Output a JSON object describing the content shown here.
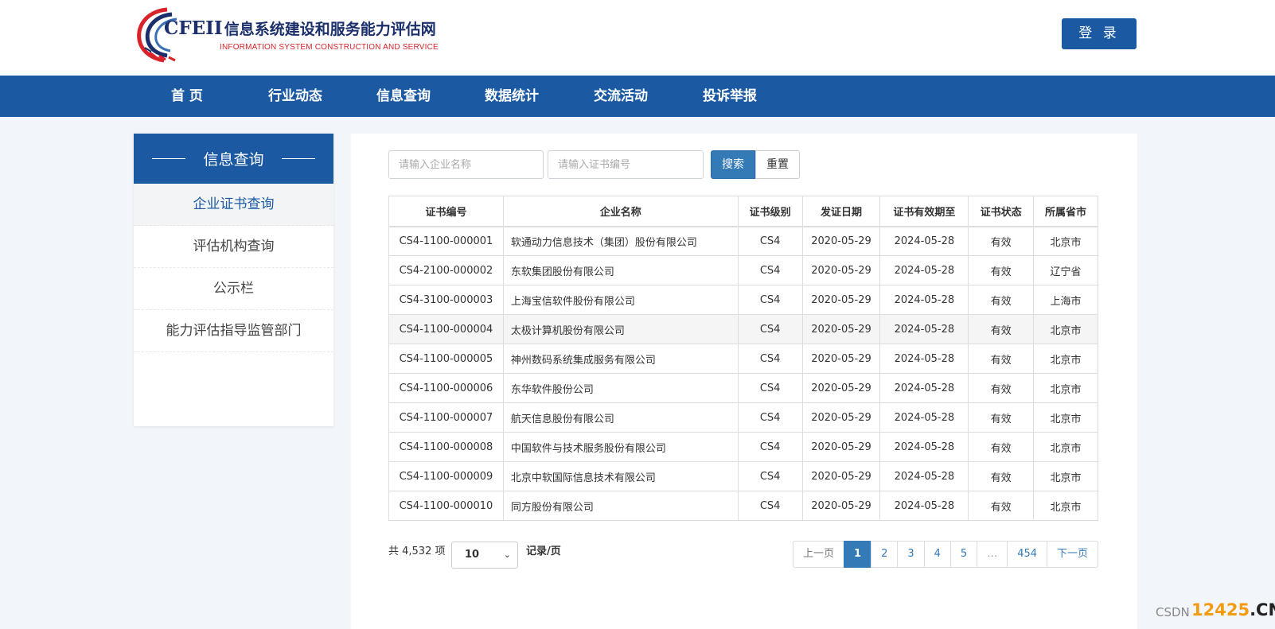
{
  "brand": {
    "abbr": "CFEII",
    "name_cn": "信息系统建设和服务能力评估网",
    "name_en": "INFORMATION SYSTEM CONSTRUCTION AND SERVICE",
    "colors": {
      "primary": "#1b5aa3",
      "accent_red": "#d8232a"
    }
  },
  "header": {
    "login_label": "登 录"
  },
  "nav": {
    "items": [
      {
        "label": "首 页"
      },
      {
        "label": "行业动态"
      },
      {
        "label": "信息查询"
      },
      {
        "label": "数据统计"
      },
      {
        "label": "交流活动"
      },
      {
        "label": "投诉举报"
      }
    ]
  },
  "sidebar": {
    "title": "信息查询",
    "items": [
      {
        "label": "企业证书查询",
        "active": true
      },
      {
        "label": "评估机构查询",
        "active": false
      },
      {
        "label": "公示栏",
        "active": false
      },
      {
        "label": "能力评估指导监管部门",
        "active": false
      }
    ]
  },
  "search": {
    "company_placeholder": "请输入企业名称",
    "cert_placeholder": "请输入证书编号",
    "search_label": "搜索",
    "reset_label": "重置"
  },
  "table": {
    "columns": [
      "证书编号",
      "企业名称",
      "证书级别",
      "发证日期",
      "证书有效期至",
      "证书状态",
      "所属省市"
    ],
    "rows": [
      [
        "CS4-1100-000001",
        "软通动力信息技术（集团）股份有限公司",
        "CS4",
        "2020-05-29",
        "2024-05-28",
        "有效",
        "北京市"
      ],
      [
        "CS4-2100-000002",
        "东软集团股份有限公司",
        "CS4",
        "2020-05-29",
        "2024-05-28",
        "有效",
        "辽宁省"
      ],
      [
        "CS4-3100-000003",
        "上海宝信软件股份有限公司",
        "CS4",
        "2020-05-29",
        "2024-05-28",
        "有效",
        "上海市"
      ],
      [
        "CS4-1100-000004",
        "太极计算机股份有限公司",
        "CS4",
        "2020-05-29",
        "2024-05-28",
        "有效",
        "北京市"
      ],
      [
        "CS4-1100-000005",
        "神州数码系统集成服务有限公司",
        "CS4",
        "2020-05-29",
        "2024-05-28",
        "有效",
        "北京市"
      ],
      [
        "CS4-1100-000006",
        "东华软件股份公司",
        "CS4",
        "2020-05-29",
        "2024-05-28",
        "有效",
        "北京市"
      ],
      [
        "CS4-1100-000007",
        "航天信息股份有限公司",
        "CS4",
        "2020-05-29",
        "2024-05-28",
        "有效",
        "北京市"
      ],
      [
        "CS4-1100-000008",
        "中国软件与技术服务股份有限公司",
        "CS4",
        "2020-05-29",
        "2024-05-28",
        "有效",
        "北京市"
      ],
      [
        "CS4-1100-000009",
        "北京中软国际信息技术有限公司",
        "CS4",
        "2020-05-29",
        "2024-05-28",
        "有效",
        "北京市"
      ],
      [
        "CS4-1100-000010",
        "同方股份有限公司",
        "CS4",
        "2020-05-29",
        "2024-05-28",
        "有效",
        "北京市"
      ]
    ],
    "highlighted_row": 3
  },
  "pagination": {
    "total_label": "共 4,532 项",
    "page_size": "10",
    "per_page_label": "记录/页",
    "prev_label": "上一页",
    "next_label": "下一页",
    "pages": [
      "1",
      "2",
      "3",
      "4",
      "5",
      "…",
      "454"
    ],
    "current": "1"
  },
  "watermark": {
    "prefix": "CSDN",
    "site": "12425",
    "tld": ".CN"
  }
}
